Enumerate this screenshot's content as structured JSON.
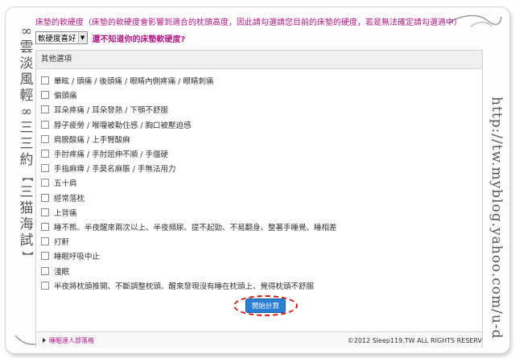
{
  "firmness_text": "床墊的軟硬度（床墊的軟硬度會影響到適合的枕頭高度，因此請勾選請您目前的床墊的硬度，若是無法確定請勾選適中）",
  "firmness_select": {
    "value": "軟硬度喜好"
  },
  "firmness_hint": "還不知道你的床墊軟硬度?",
  "panel_title": "其他選項",
  "options": [
    "暈眩 / 頭痛 / 後頭痛 / 眼睛內側疼痛 / 眼睛刺痛",
    "偏頭痛",
    "耳朵疼痛 / 耳朵發熱 / 下顎不舒服",
    "脖子疲勞 / 喉嚨被勒住感 / 胸口被壓迫感",
    "肩膀酸痛 / 上手臂酸麻",
    "手肘疼痛 / 手肘屈伸不順 / 手僵硬",
    "手指麻痺 / 手莫名麻脹 / 手無法用力",
    "五十肩",
    "經常落枕",
    "上背痛",
    "睡不熊、半夜醒來兩次以上、半夜頻尿、提不起勁、不易翻身、整著手睡覺、睡相差",
    "打鼾",
    "睡眠呼吸中止",
    "淺眠",
    "半夜將枕頭推開、不斷調整枕頭、醒來發現沒有睡在枕頭上、覺得枕頭不舒服"
  ],
  "start_button": "開始計算",
  "footer": {
    "link": "睡眠達人部落格",
    "copyright": "©2012 Sleep119.TW ALL RIGHTS RESERV"
  },
  "watermark_left": [
    "∞",
    "雲",
    "淡",
    "風",
    "輕",
    "∞",
    "三",
    "三",
    "約",
    "【",
    "三",
    "猫",
    "海",
    "試",
    "】"
  ],
  "watermark_right": "http://tw.myblog.yahoo.com/u-d",
  "colors": {
    "accent": "#b01a86",
    "button": "#2a7fd4",
    "highlight": "#d41818"
  }
}
